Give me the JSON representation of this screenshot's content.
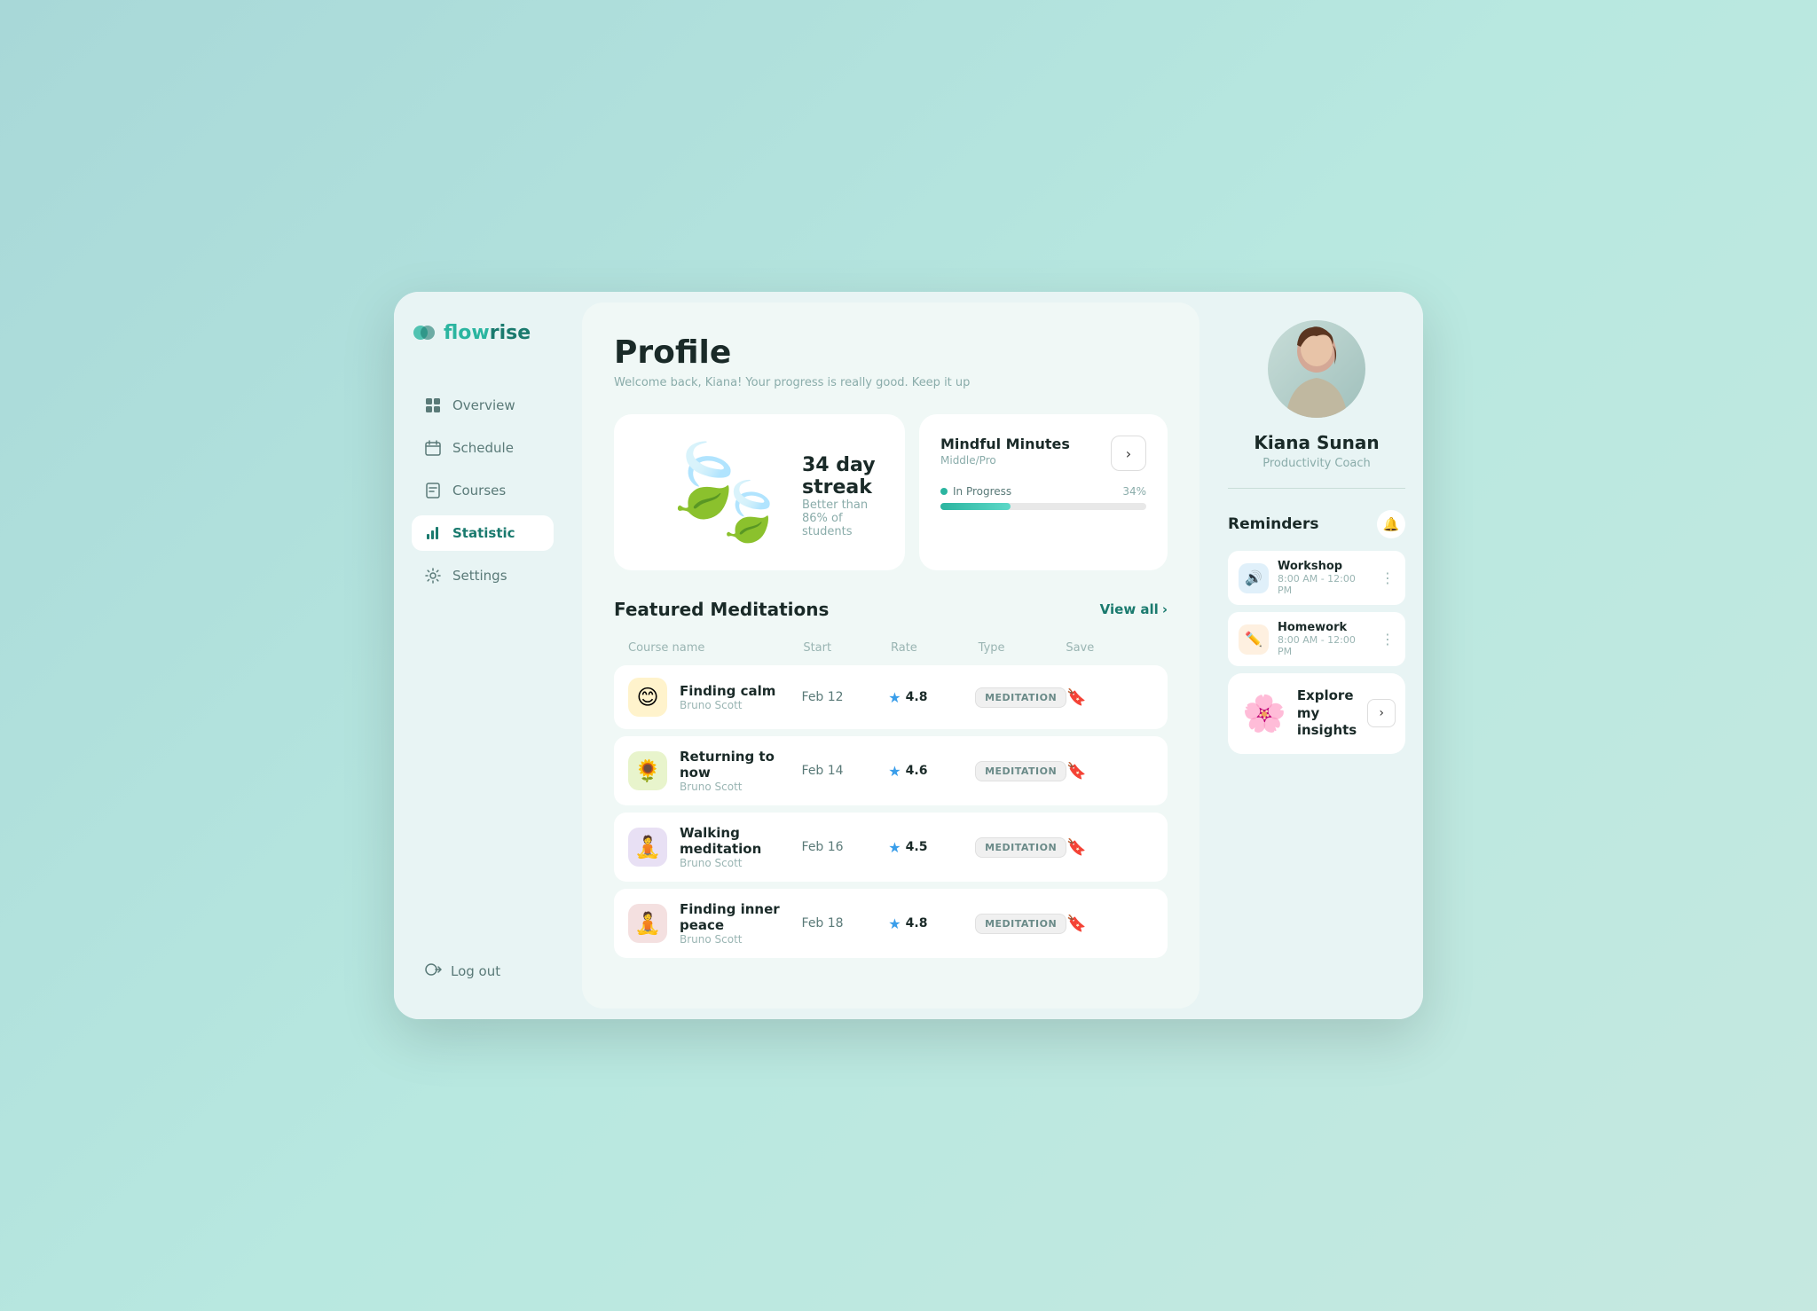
{
  "app": {
    "name": "flowrise",
    "name_part1": "flow",
    "name_part2": "rise"
  },
  "sidebar": {
    "nav_items": [
      {
        "id": "overview",
        "label": "Overview",
        "icon": "⊞",
        "active": false
      },
      {
        "id": "schedule",
        "label": "Schedule",
        "icon": "📅",
        "active": false
      },
      {
        "id": "courses",
        "label": "Courses",
        "icon": "📋",
        "active": false
      },
      {
        "id": "statistic",
        "label": "Statistic",
        "icon": "📊",
        "active": false
      },
      {
        "id": "settings",
        "label": "Settings",
        "icon": "⚙️",
        "active": false
      }
    ],
    "logout_label": "Log out"
  },
  "profile": {
    "page_title": "Profile",
    "page_subtitle": "Welcome back, Kiana! Your progress is really good. Keep it up"
  },
  "streak": {
    "label": "34 day streak",
    "sub_label": "Better than 86% of students"
  },
  "mindful_card": {
    "title": "Mindful Minutes",
    "level": "Middle/Pro",
    "arrow_label": "›",
    "progress_label": "In Progress",
    "progress_pct": "34%",
    "progress_value": 34
  },
  "featured": {
    "section_title": "Featured Meditations",
    "view_all": "View all",
    "columns": [
      "Course name",
      "Start",
      "Rate",
      "Type",
      "Save"
    ],
    "courses": [
      {
        "name": "Finding calm",
        "author": "Bruno Scott",
        "start": "Feb 12",
        "rate": "4.8",
        "type": "MEDITATION",
        "emoji": "😊",
        "bg": "#fff3cc"
      },
      {
        "name": "Returning to now",
        "author": "Bruno Scott",
        "start": "Feb 14",
        "rate": "4.6",
        "type": "MEDITATION",
        "emoji": "🌻",
        "bg": "#e8f4cc"
      },
      {
        "name": "Walking meditation",
        "author": "Bruno Scott",
        "start": "Feb 16",
        "rate": "4.5",
        "type": "MEDITATION",
        "emoji": "🧘",
        "bg": "#e8e0f4"
      },
      {
        "name": "Finding inner peace",
        "author": "Bruno Scott",
        "start": "Feb 18",
        "rate": "4.8",
        "type": "MEDITATION",
        "emoji": "🧘",
        "bg": "#f4e0e0"
      }
    ]
  },
  "user": {
    "name": "Kiana Sunan",
    "role": "Productivity Coach"
  },
  "reminders": {
    "title": "Reminders",
    "items": [
      {
        "name": "Workshop",
        "time": "8:00 AM - 12:00 PM",
        "icon": "🔊",
        "icon_class": "reminder-icon-blue"
      },
      {
        "name": "Homework",
        "time": "8:00 AM - 12:00 PM",
        "icon": "✏️",
        "icon_class": "reminder-icon-orange"
      }
    ]
  },
  "insights": {
    "label": "Explore my insights",
    "icon": "🌸"
  }
}
